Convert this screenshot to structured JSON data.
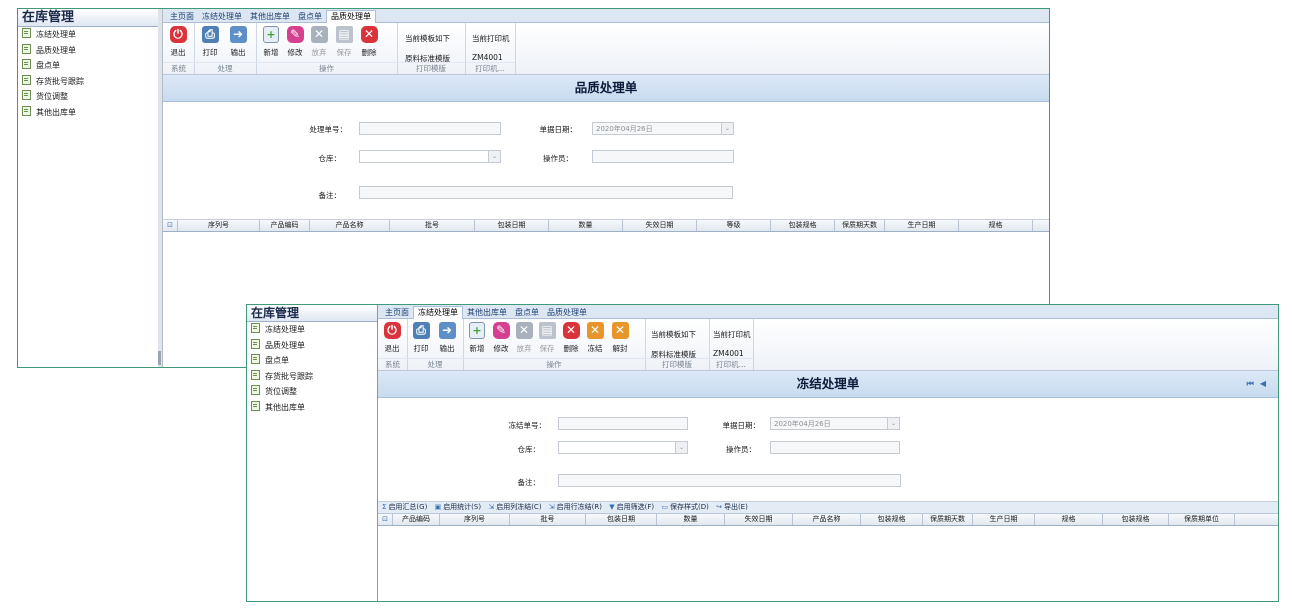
{
  "window1": {
    "sidebar_title": "在库管理",
    "sidebar_items": [
      "冻结处理单",
      "品质处理单",
      "盘点单",
      "存货批号跟踪",
      "货位调整",
      "其他出库单"
    ],
    "tabs": [
      "主页面",
      "冻结处理单",
      "其他出库单",
      "盘点单",
      "品质处理单"
    ],
    "active_tab": "品质处理单",
    "ribbon": {
      "exit": "退出",
      "print": "打印",
      "output": "输出",
      "new": "新增",
      "edit": "修改",
      "abandon": "放弃",
      "save": "保存",
      "delete": "删除",
      "template_current": "当前模板如下",
      "template_name": "原料标准模版",
      "printer_current": "当前打印机",
      "printer_name": "ZM4001",
      "group_system": "系统",
      "group_process": "处理",
      "group_operate": "操作",
      "group_template": "打印模版",
      "group_printer": "打印机..."
    },
    "form_title": "品质处理单",
    "labels": {
      "doc_no": "处理单号：",
      "date": "单据日期：",
      "warehouse": "仓库：",
      "operator": "操作员：",
      "remark": "备注："
    },
    "values": {
      "doc_no": "",
      "date": "2020年04月26日",
      "warehouse": "",
      "operator": "",
      "remark": ""
    },
    "columns": [
      "序列号",
      "产品编码",
      "产品名称",
      "批号",
      "包装日期",
      "数量",
      "失效日期",
      "等级",
      "包装规格",
      "保质期天数",
      "生产日期",
      "规格"
    ]
  },
  "window2": {
    "sidebar_title": "在库管理",
    "sidebar_items": [
      "冻结处理单",
      "品质处理单",
      "盘点单",
      "存货批号跟踪",
      "货位调整",
      "其他出库单"
    ],
    "tabs": [
      "主页面",
      "冻结处理单",
      "其他出库单",
      "盘点单",
      "品质处理单"
    ],
    "active_tab": "冻结处理单",
    "ribbon": {
      "exit": "退出",
      "print": "打印",
      "output": "输出",
      "new": "新增",
      "edit": "修改",
      "abandon": "放弃",
      "save": "保存",
      "delete": "删除",
      "freeze": "冻结",
      "unfreeze": "解封",
      "template_current": "当前模板如下",
      "template_name": "原料标准模版",
      "printer_current": "当前打印机",
      "printer_name": "ZM4001",
      "group_system": "系统",
      "group_process": "处理",
      "group_operate": "操作",
      "group_template": "打印模版",
      "group_printer": "打印机..."
    },
    "form_title": "冻结处理单",
    "labels": {
      "doc_no": "冻结单号：",
      "date": "单据日期：",
      "warehouse": "仓库：",
      "operator": "操作员：",
      "remark": "备注："
    },
    "values": {
      "doc_no": "",
      "date": "2020年04月26日",
      "warehouse": "",
      "operator": "",
      "remark": ""
    },
    "grid_toolbar": [
      "启用汇总(G)",
      "启用统计(S)",
      "启用列冻结(C)",
      "启用行冻结(R)",
      "启用筛选(F)",
      "保存样式(D)",
      "导出(E)"
    ],
    "columns": [
      "产品编码",
      "序列号",
      "批号",
      "包装日期",
      "数量",
      "失效日期",
      "产品名称",
      "包装规格",
      "保质期天数",
      "生产日期",
      "规格",
      "包装规格",
      "保质期单位"
    ]
  }
}
